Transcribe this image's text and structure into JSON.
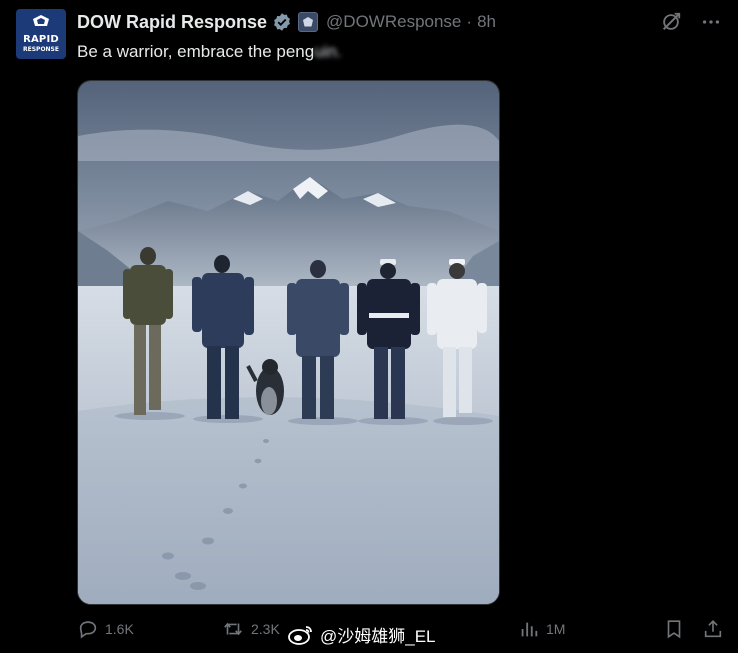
{
  "post": {
    "display_name": "DOW Rapid Response",
    "handle": "@DOWResponse",
    "separator": "·",
    "time": "8h",
    "text_visible": "Be a warrior, embrace the peng",
    "text_blurred": "uin.",
    "avatar": {
      "line1": "RAPID",
      "line2": "RESPONSE",
      "bg_color": "#1d3a78"
    },
    "verified_color": "#829aab"
  },
  "header_icons": [
    "grok-icon",
    "more-icon"
  ],
  "actions": {
    "reply_count": "1.6K",
    "repost_count": "2.3K",
    "like_count": "",
    "views_count": "1M"
  },
  "watermark": {
    "text": "@沙姆雄狮_EL",
    "logo": "weibo-logo"
  },
  "colors": {
    "background": "#000000",
    "text": "#e7e9ea",
    "muted": "#71767b"
  }
}
